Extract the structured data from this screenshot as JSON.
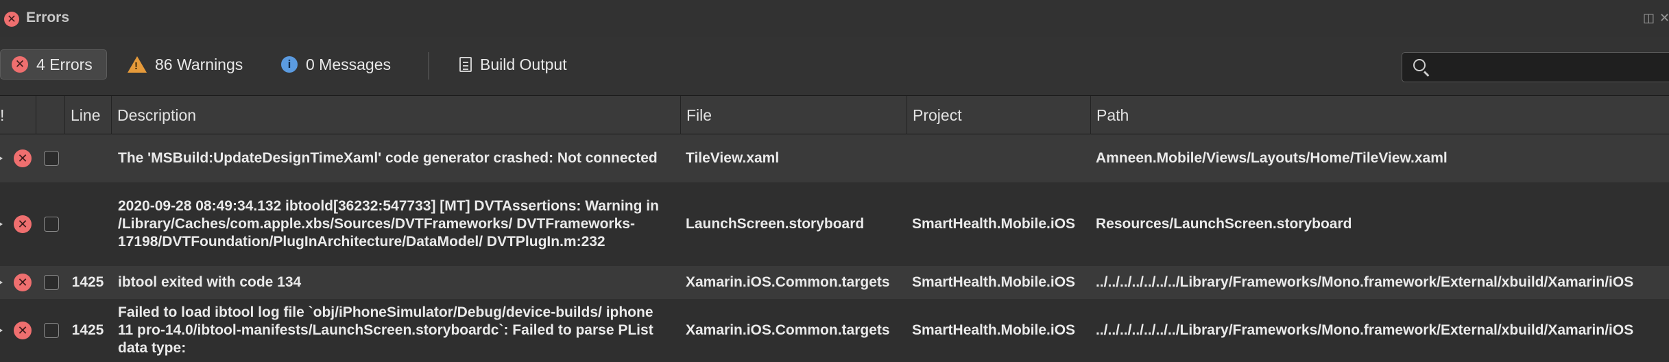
{
  "window": {
    "title": "Errors",
    "controls": [
      "◫",
      "✕"
    ]
  },
  "toolbar": {
    "errors_label": "4 Errors",
    "warnings_label": "86 Warnings",
    "messages_label": "0 Messages",
    "build_output_label": "Build Output",
    "search_placeholder": ""
  },
  "columns": [
    "!",
    "",
    "Line",
    "Description",
    "File",
    "Project",
    "Path"
  ],
  "rows": [
    {
      "line": "",
      "description": "The 'MSBuild:UpdateDesignTimeXaml' code generator crashed: Not connected",
      "file": "TileView.xaml",
      "project": "",
      "path": "Amneen.Mobile/Views/Layouts/Home/TileView.xaml"
    },
    {
      "line": "",
      "description": "2020-09-28 08:49:34.132 ibtoold[36232:547733] [MT] DVTAssertions: Warning in /Library/Caches/com.apple.xbs/Sources/DVTFrameworks/ DVTFrameworks-17198/DVTFoundation/PlugInArchitecture/DataModel/ DVTPlugIn.m:232",
      "file": "LaunchScreen.storyboard",
      "project": "SmartHealth.Mobile.iOS",
      "path": "Resources/LaunchScreen.storyboard"
    },
    {
      "line": "1425",
      "description": "ibtool exited with code 134",
      "file": "Xamarin.iOS.Common.targets",
      "project": "SmartHealth.Mobile.iOS",
      "path": "../../../../../../../Library/Frameworks/Mono.framework/External/xbuild/Xamarin/iOS"
    },
    {
      "line": "1425",
      "description": "Failed to load ibtool log file `obj/iPhoneSimulator/Debug/device-builds/ iphone 11 pro-14.0/ibtool-manifests/LaunchScreen.storyboardc`: Failed to parse PList data type:",
      "file": "Xamarin.iOS.Common.targets",
      "project": "SmartHealth.Mobile.iOS",
      "path": "../../../../../../../Library/Frameworks/Mono.framework/External/xbuild/Xamarin/iOS"
    }
  ],
  "colors": {
    "error": "#ef6f6f",
    "warning": "#e69a3a",
    "info": "#5b9be0"
  }
}
